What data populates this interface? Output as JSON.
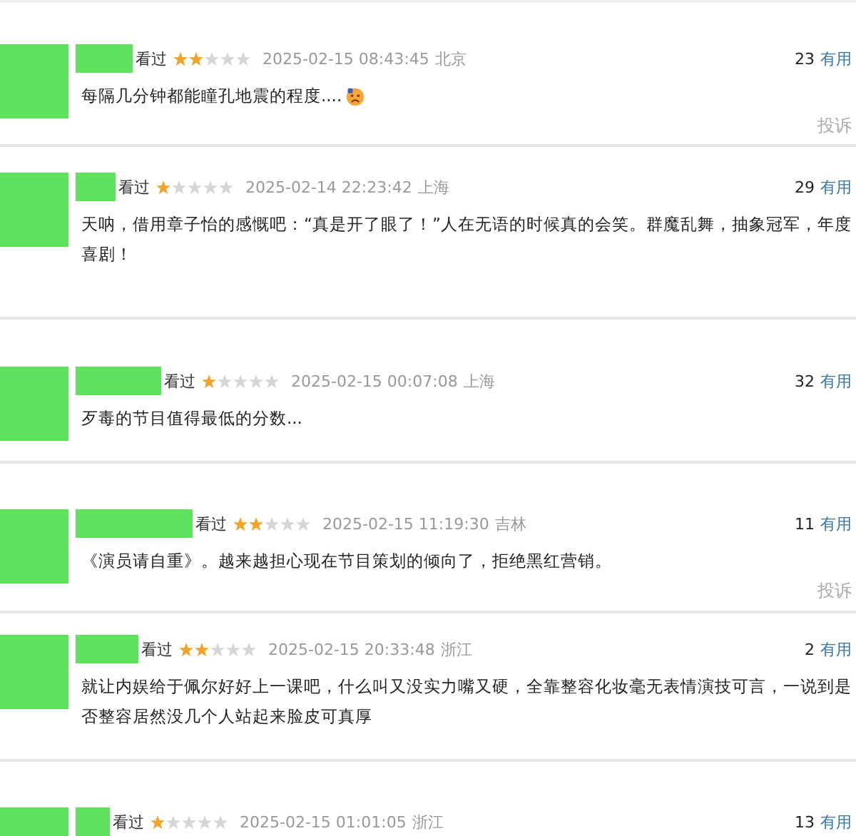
{
  "comments": [
    {
      "status": "看过",
      "stars": 2,
      "time": "2025-02-15 08:43:45",
      "location": "北京",
      "votes": "23",
      "useful": "有用",
      "text": "每隔几分钟都能瞳孔地震的程度....",
      "emoji": true,
      "report": "投诉"
    },
    {
      "status": "看过",
      "stars": 1,
      "time": "2025-02-14 22:23:42",
      "location": "上海",
      "votes": "29",
      "useful": "有用",
      "text": "天呐，借用章子怡的感慨吧：“真是开了眼了！”人在无语的时候真的会笑。群魔乱舞，抽象冠军，年度喜剧！"
    },
    {
      "status": "看过",
      "stars": 1,
      "time": "2025-02-15 00:07:08",
      "location": "上海",
      "votes": "32",
      "useful": "有用",
      "text": "歹毒的节目值得最低的分数..."
    },
    {
      "status": "看过",
      "stars": 2,
      "time": "2025-02-15 11:19:30",
      "location": "吉林",
      "votes": "11",
      "useful": "有用",
      "text": "《演员请自重》。越来越担心现在节目策划的倾向了，拒绝黑红营销。",
      "report": "投诉"
    },
    {
      "status": "看过",
      "stars": 2,
      "time": "2025-02-15 20:33:48",
      "location": "浙江",
      "votes": "2",
      "useful": "有用",
      "text": "就让内娱给于佩尔好好上一课吧，什么叫又没实力嘴又硬，全靠整容化妆毫无表情演技可言，一说到是否整容居然没几个人站起来脸皮可真厚"
    },
    {
      "status": "看过",
      "stars": 1,
      "time": "2025-02-15 01:01:05",
      "location": "浙江",
      "votes": "13",
      "useful": "有用"
    }
  ]
}
